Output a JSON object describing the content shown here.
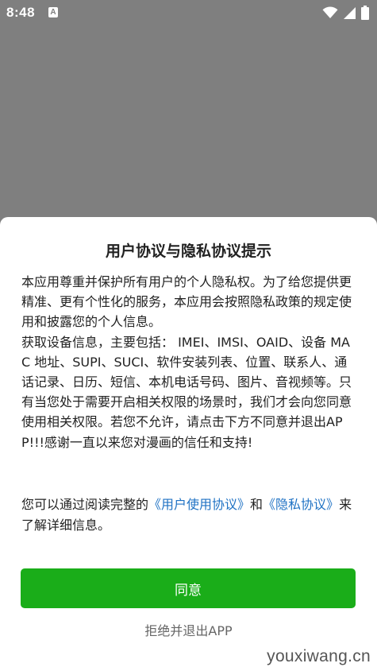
{
  "status_bar": {
    "time": "8:48",
    "notification_glyph": "A",
    "icons": [
      "wifi-icon",
      "signal-icon",
      "battery-icon"
    ]
  },
  "dialog": {
    "title": "用户协议与隐私协议提示",
    "paragraph1": "本应用尊重并保护所有用户的个人隐私权。为了给您提供更精准、更有个性化的服务，本应用会按照隐私政策的规定使用和披露您的个人信息。",
    "paragraph2": "获取设备信息，主要包括： IMEI、IMSI、OAID、设备 MAC 地址、SUPI、SUCI、软件安装列表、位置、联系人、通话记录、日历、短信、本机电话号码、图片、音视频等。只有当您处于需要开启相关权限的场景时，我们才会向您同意使用相关权限。若您不允许，请点击下方不同意并退出APP!!!感谢一直以来您对漫画的信任和支持!",
    "links": {
      "prefix": "您可以通过阅读完整的",
      "user_agreement": "《用户使用协议》",
      "and": "和",
      "privacy_agreement": "《隐私协议》",
      "suffix": "来了解详细信息。"
    },
    "agree_label": "同意",
    "decline_label": "拒绝并退出APP"
  },
  "watermark": "youxiwang.cn",
  "colors": {
    "overlay": "#7f7f7f",
    "agree_button": "#1aad19",
    "link": "#1f72c4"
  }
}
